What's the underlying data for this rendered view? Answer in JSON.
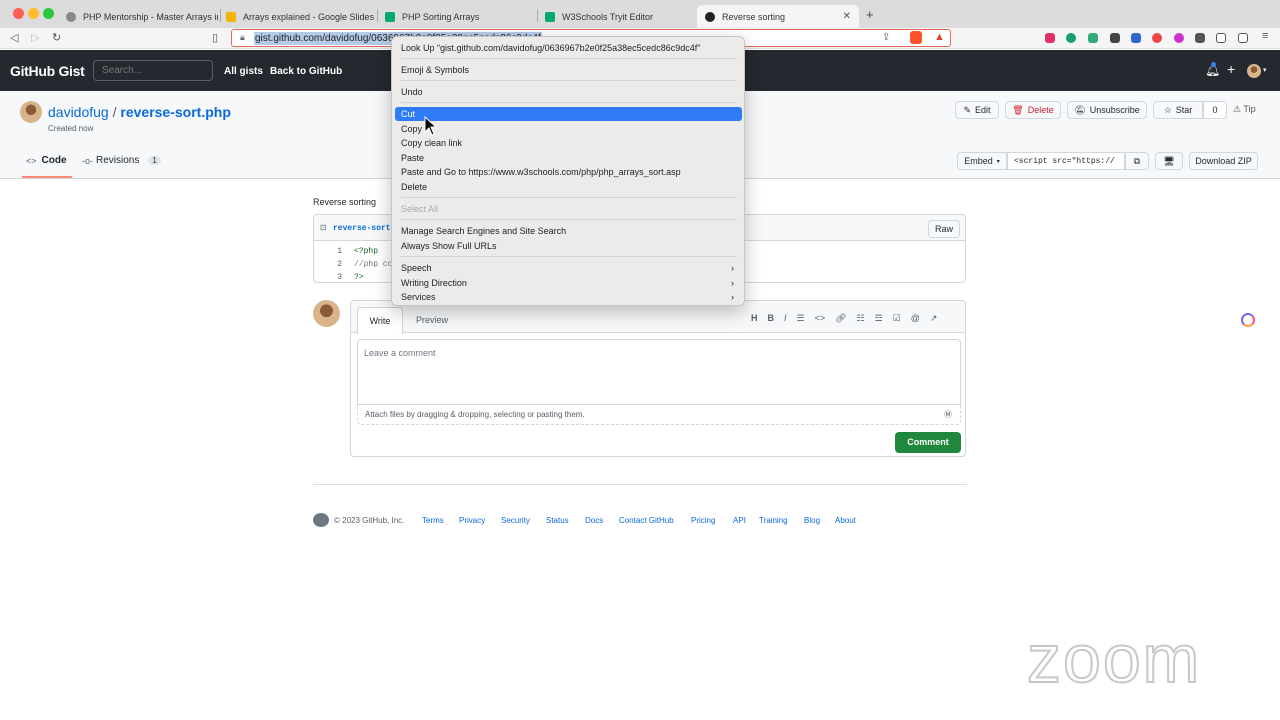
{
  "browser": {
    "tabs": [
      {
        "label": "PHP Mentorship - Master Arrays in"
      },
      {
        "label": "Arrays explained - Google Slides"
      },
      {
        "label": "PHP Sorting Arrays"
      },
      {
        "label": "W3Schools Tryit Editor"
      },
      {
        "label": "Reverse sorting"
      }
    ],
    "new_tab": "+",
    "url": "gist.github.com/davidofug/0636967b2e0f25a38ec5cedc86c9dc4f"
  },
  "github": {
    "logo": "GitHub Gist",
    "search_placeholder": "Search...",
    "all_gists": "All gists",
    "back": "Back to GitHub"
  },
  "gist": {
    "owner": "davidofug",
    "sep": "/",
    "name": "reverse-sort.php",
    "created": "Created now",
    "actions": {
      "edit": "Edit",
      "delete": "Delete",
      "unsubscribe": "Unsubscribe",
      "star": "Star",
      "star_count": "0",
      "tip": "Tip"
    },
    "tabs": {
      "code": "Code",
      "revisions": "Revisions",
      "revisions_count": "1"
    },
    "embed": "Embed",
    "embed_value": "<script src=\"https://",
    "download": "Download ZIP",
    "description": "Reverse sorting",
    "file_name": "reverse-sort",
    "raw": "Raw",
    "lines": [
      {
        "num": "1",
        "code": "<?php"
      },
      {
        "num": "2",
        "code": "//php co"
      },
      {
        "num": "3",
        "code": "?>"
      }
    ]
  },
  "comment": {
    "write": "Write",
    "preview": "Preview",
    "placeholder": "Leave a comment",
    "attach": "Attach files by dragging & dropping, selecting or pasting them.",
    "submit": "Comment",
    "toolbar_h": "H",
    "toolbar_b": "B",
    "toolbar_i": "I"
  },
  "footer": {
    "copyright": "© 2023 GitHub, Inc.",
    "links": [
      "Terms",
      "Privacy",
      "Security",
      "Status",
      "Docs",
      "Contact GitHub",
      "Pricing",
      "API",
      "Training",
      "Blog",
      "About"
    ]
  },
  "context_menu": {
    "lookup": "Look Up “gist.github.com/davidofug/0636967b2e0f25a38ec5cedc86c9dc4f”",
    "emoji": "Emoji & Symbols",
    "undo": "Undo",
    "cut": "Cut",
    "copy": "Copy",
    "copy_clean": "Copy clean link",
    "paste": "Paste",
    "paste_go": "Paste and Go to https://www.w3schools.com/php/php_arrays_sort.asp",
    "delete": "Delete",
    "select_all": "Select All",
    "manage": "Manage Search Engines and Site Search",
    "full_urls": "Always Show Full URLs",
    "speech": "Speech",
    "writing": "Writing Direction",
    "services": "Services",
    "submenu_arrow": "›"
  },
  "watermark": "zoom",
  "colors": {
    "accent_green": "#1f883d",
    "link_blue": "#0969da",
    "menu_highlight": "#2f7cf6",
    "header_dark": "#24292f"
  }
}
